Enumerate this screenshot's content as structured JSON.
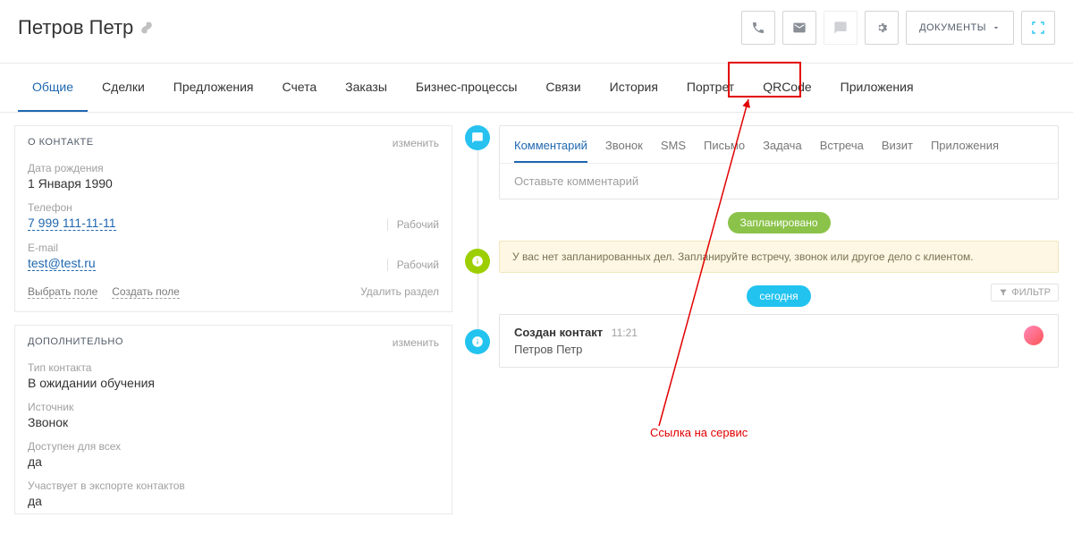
{
  "header": {
    "title": "Петров Петр",
    "docs_button": "ДОКУМЕНТЫ"
  },
  "tabs": [
    "Общие",
    "Сделки",
    "Предложения",
    "Счета",
    "Заказы",
    "Бизнес-процессы",
    "Связи",
    "История",
    "Портрет",
    "QRCode",
    "Приложения"
  ],
  "contact_panel": {
    "title": "О КОНТАКТЕ",
    "edit": "изменить",
    "fields": {
      "dob_label": "Дата рождения",
      "dob_value": "1 Января 1990",
      "phone_label": "Телефон",
      "phone_value": "7 999 111-11-11",
      "phone_type": "Рабочий",
      "email_label": "E-mail",
      "email_value": "test@test.ru",
      "email_type": "Рабочий"
    },
    "footer": {
      "select_field": "Выбрать поле",
      "create_field": "Создать поле",
      "delete_section": "Удалить раздел"
    }
  },
  "additional_panel": {
    "title": "ДОПОЛНИТЕЛЬНО",
    "edit": "изменить",
    "fields": {
      "type_label": "Тип контакта",
      "type_value": "В ожидании обучения",
      "source_label": "Источник",
      "source_value": "Звонок",
      "avail_label": "Доступен для всех",
      "avail_value": "да",
      "export_label": "Участвует в экспорте контактов",
      "export_value": "да"
    }
  },
  "timeline": {
    "comment_tabs": [
      "Комментарий",
      "Звонок",
      "SMS",
      "Письмо",
      "Задача",
      "Встреча",
      "Визит",
      "Приложения"
    ],
    "placeholder": "Оставьте комментарий",
    "planned_badge": "Запланировано",
    "no_plans": "У вас нет запланированных дел. Запланируйте встречу, звонок или другое дело с клиентом.",
    "today_badge": "сегодня",
    "filter": "ФИЛЬТР",
    "created_title": "Создан контакт",
    "created_time": "11:21",
    "created_name": "Петров Петр"
  },
  "annotation": {
    "text": "Ссылка на сервис"
  }
}
